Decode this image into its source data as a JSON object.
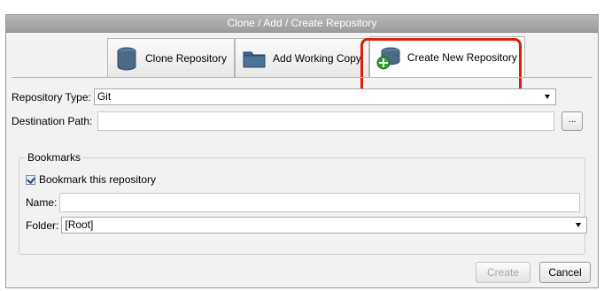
{
  "window": {
    "title": "Clone / Add / Create Repository"
  },
  "tabs": [
    {
      "label": "Clone Repository",
      "icon": "database-stack-icon"
    },
    {
      "label": "Add Working Copy",
      "icon": "folder-icon"
    },
    {
      "label": "Create New Repository",
      "icon": "database-add-icon",
      "active": true
    }
  ],
  "form": {
    "repository_type_label": "Repository Type:",
    "repository_type_value": "Git",
    "destination_path_label": "Destination Path:",
    "destination_path_value": "",
    "browse_label": "..."
  },
  "bookmarks": {
    "group_title": "Bookmarks",
    "checkbox_label": "Bookmark this repository",
    "checked": true,
    "name_label": "Name:",
    "name_value": "",
    "folder_label": "Folder:",
    "folder_value": "[Root]"
  },
  "buttons": {
    "create_label": "Create",
    "cancel_label": "Cancel"
  },
  "colors": {
    "highlight": "#dd1c0c",
    "titlebar": "#a8a8a8"
  }
}
